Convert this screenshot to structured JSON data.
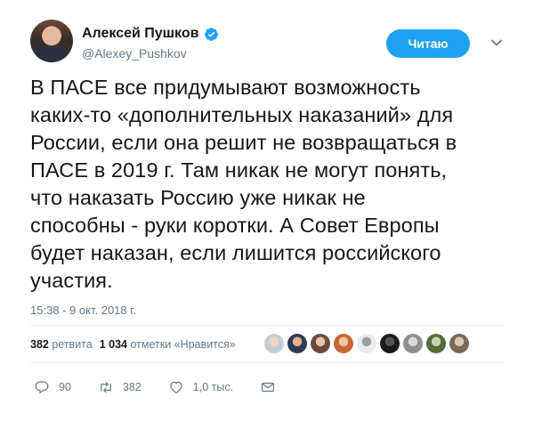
{
  "author": {
    "name": "Алексей Пушков",
    "handle": "@Alexey_Pushkov",
    "verified": true
  },
  "follow_button": {
    "label": "Читаю"
  },
  "tweet": {
    "text": "В ПАСЕ все придумывают возможность\nкаких-то «дополнительных наказаний» для\nРоссии, если она решит не возвращаться в\nПАСЕ в 2019 г. Там никак не могут понять,\nчто наказать Россию уже никак не\nспособны - руки коротки. А Совет Европы\nбудет наказан, если лишится российского\nучастия.",
    "timestamp": "15:38 - 9 окт. 2018 г."
  },
  "stats": {
    "retweets_count": "382",
    "retweets_label": "ретвита",
    "likes_count": "1 034",
    "likes_label": "отметки «Нравится»"
  },
  "actions": {
    "replies": "90",
    "retweets": "382",
    "likes": "1,0 тыс."
  },
  "colors": {
    "accent": "#1da1f2",
    "secondary_text": "#657786",
    "divider": "#e6ecf0"
  }
}
